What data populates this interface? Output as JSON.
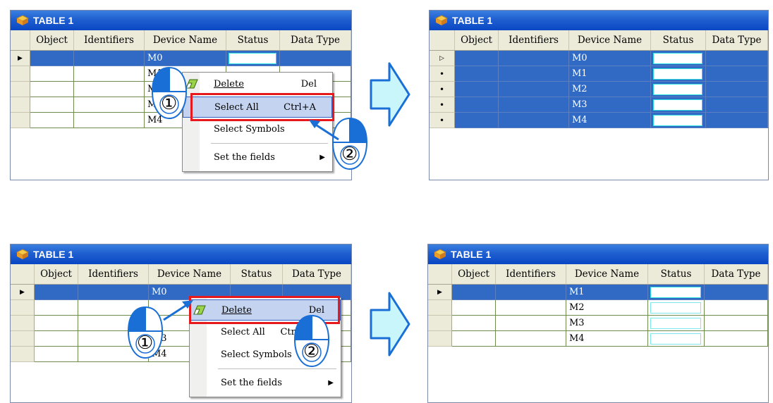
{
  "panels": [
    {
      "title": "TABLE 1",
      "columns": [
        "Object",
        "Identifiers",
        "Device Name",
        "Status",
        "Data Type"
      ],
      "rows": [
        "M0",
        "M1",
        "M2",
        "M3",
        "M4"
      ],
      "menu": {
        "delete_label": "Delete",
        "delete_shortcut": "Del",
        "select_all_label": "Select All",
        "select_all_shortcut": "Ctrl+A",
        "select_symbols_label": "Select Symbols",
        "set_fields_label": "Set the fields"
      },
      "steps": [
        "①",
        "②"
      ]
    },
    {
      "title": "TABLE 1",
      "columns": [
        "Object",
        "Identifiers",
        "Device Name",
        "Status",
        "Data Type"
      ],
      "rows": [
        "M0",
        "M1",
        "M2",
        "M3",
        "M4"
      ]
    },
    {
      "title": "TABLE 1",
      "columns": [
        "Object",
        "Identifiers",
        "Device Name",
        "Status",
        "Data Type"
      ],
      "rows": [
        "M0",
        "",
        "",
        "M3",
        "M4"
      ],
      "menu": {
        "delete_label": "Delete",
        "delete_shortcut": "Del",
        "select_all_label": "Select All",
        "select_all_shortcut": "Ctrl",
        "select_symbols_label": "Select Symbols",
        "set_fields_label": "Set the fields"
      },
      "steps": [
        "①",
        "②"
      ]
    },
    {
      "title": "TABLE 1",
      "columns": [
        "Object",
        "Identifiers",
        "Device Name",
        "Status",
        "Data Type"
      ],
      "rows": [
        "M1",
        "M2",
        "M3",
        "M4"
      ]
    }
  ],
  "colors": {
    "titlebar": "#1f5fd0",
    "selection": "#316ac5",
    "highlight_box": "#e8191c",
    "arrow_fill": "#c9f6fb",
    "arrow_stroke": "#1a6fd6",
    "mouse_blue": "#1a6fd6"
  },
  "icons": [
    "table-icon",
    "eraser-icon",
    "submenu-arrow-icon",
    "row-pointer-icon",
    "mouse-icon",
    "right-arrow-icon",
    "pointer-arrow-icon"
  ]
}
